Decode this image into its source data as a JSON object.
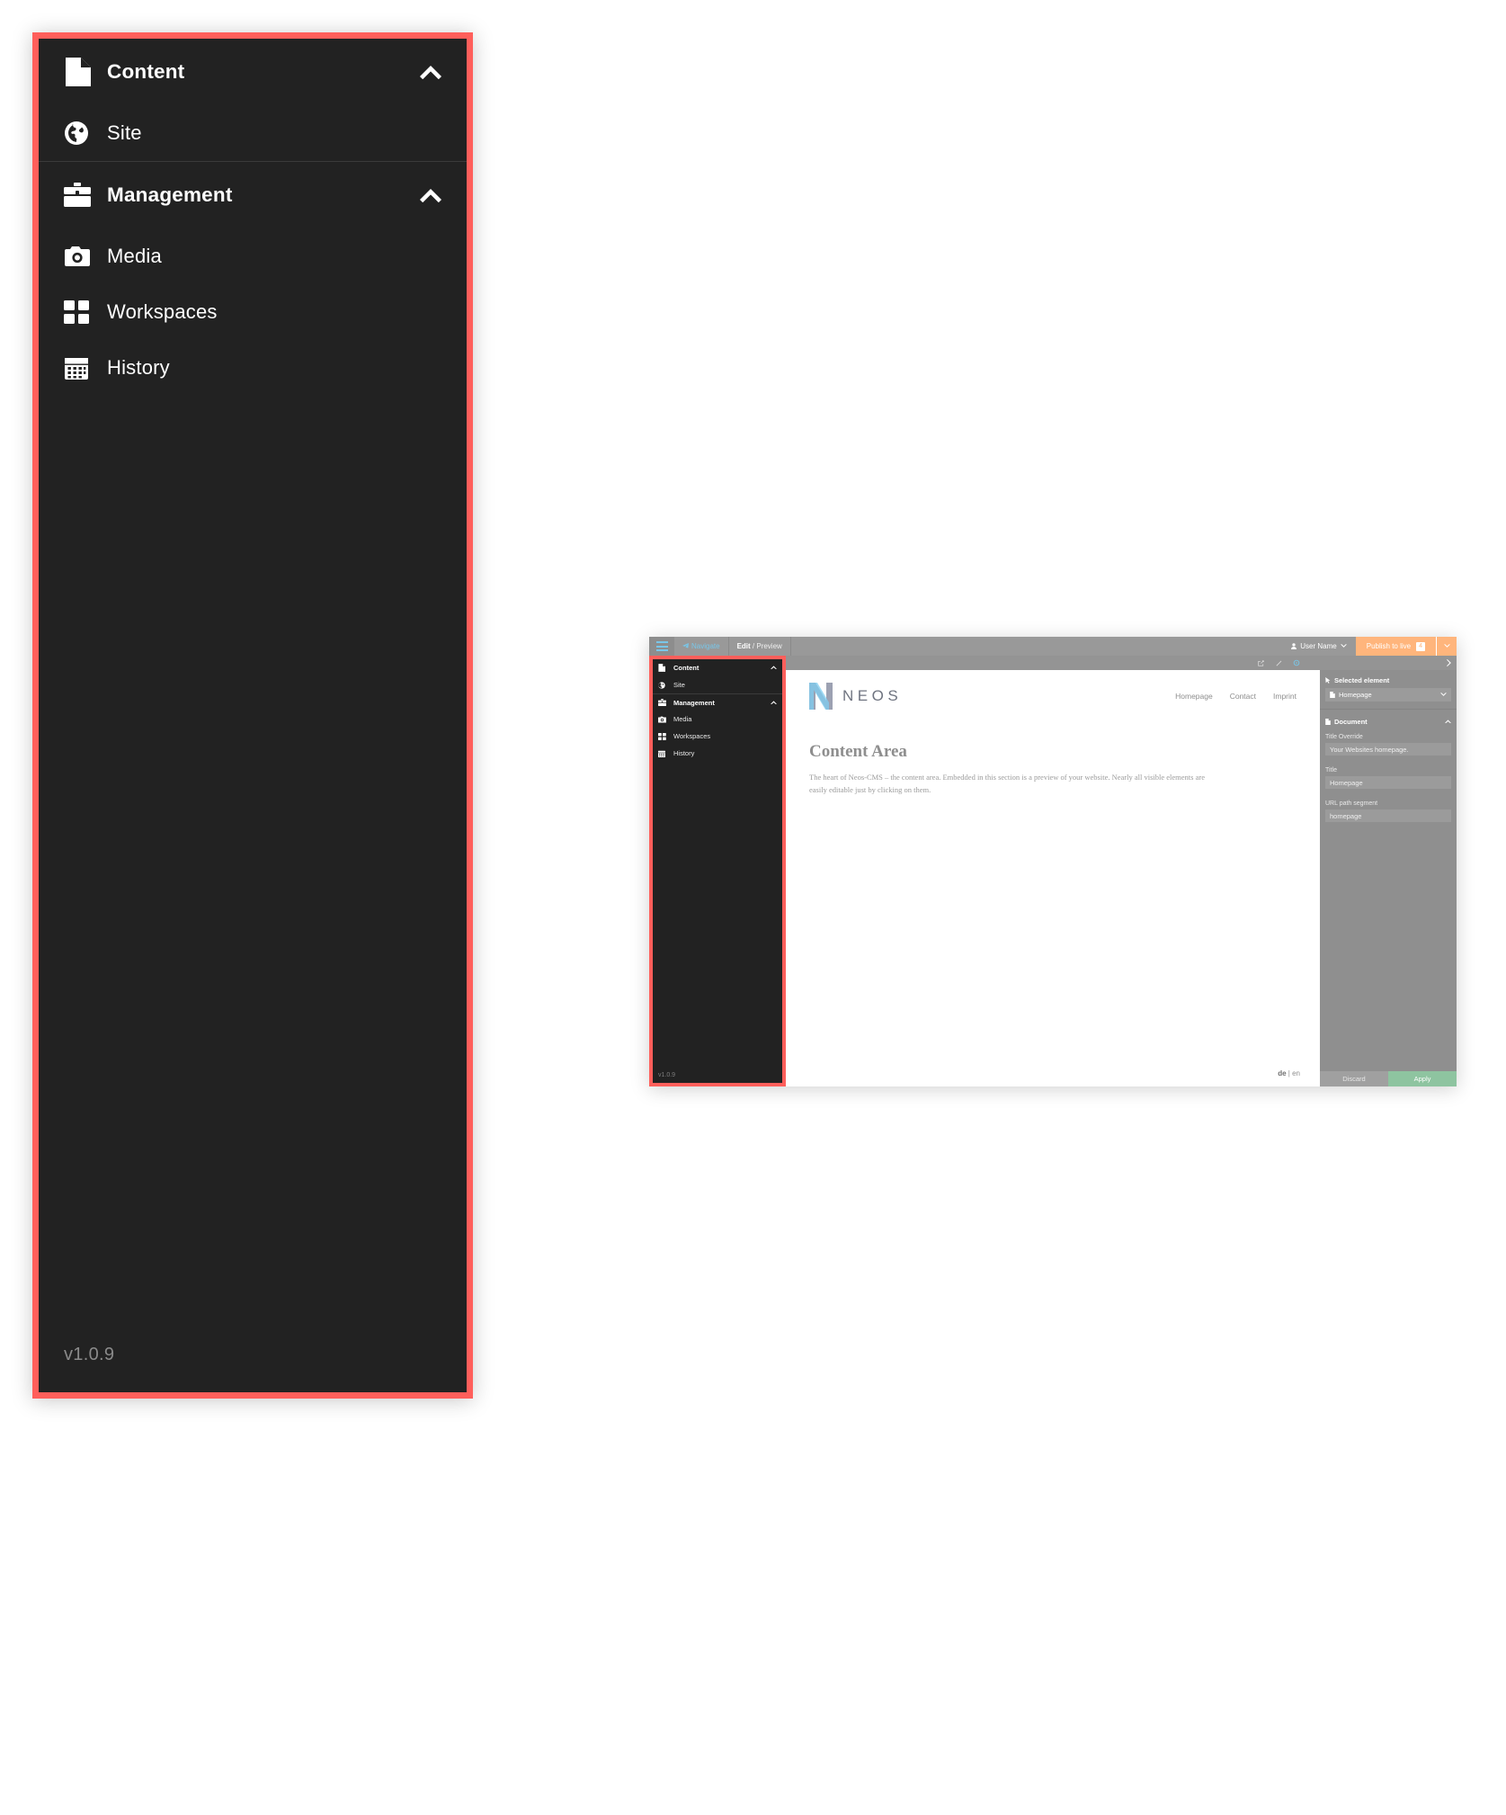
{
  "sidebar": {
    "groups": [
      {
        "header": {
          "label": "Content",
          "icon": "document-icon",
          "chevron": "chevron-up-icon"
        },
        "items": [
          {
            "label": "Site",
            "icon": "globe-icon"
          }
        ]
      },
      {
        "header": {
          "label": "Management",
          "icon": "briefcase-icon",
          "chevron": "chevron-up-icon"
        },
        "items": [
          {
            "label": "Media",
            "icon": "camera-icon"
          },
          {
            "label": "Workspaces",
            "icon": "grid-icon"
          },
          {
            "label": "History",
            "icon": "calendar-icon"
          }
        ]
      }
    ],
    "version": "v1.0.9",
    "background_color": "#222222",
    "highlight_color": "#ff5f5b"
  },
  "mini_window": {
    "topbar": {
      "menu_icon": "hamburger-icon",
      "navigate_label": "Navigate",
      "navigate_icon": "paper-plane-icon",
      "edit_label": "Edit",
      "edit_separator": " / ",
      "preview_label": "Preview",
      "user_label": "User Name",
      "user_icon": "user-icon",
      "user_caret": "chevron-down-icon",
      "publish_label": "Publish to live",
      "publish_badge": "4",
      "publish_caret": "chevron-down-icon",
      "publish_color": "#ffb57c",
      "accent_color": "#79c6e8"
    },
    "secondbar": {
      "icons": [
        "external-link-icon",
        "edit-pencil-icon",
        "gear-icon"
      ],
      "active_icon": "gear-icon",
      "arrow_icon": "chevron-right-icon"
    },
    "sidebar": {
      "groups": [
        {
          "header": {
            "label": "Content",
            "icon": "document-icon",
            "chevron": "chevron-up-icon"
          },
          "items": [
            {
              "label": "Site",
              "icon": "globe-icon"
            }
          ]
        },
        {
          "header": {
            "label": "Management",
            "icon": "briefcase-icon",
            "chevron": "chevron-up-icon"
          },
          "items": [
            {
              "label": "Media",
              "icon": "camera-icon"
            },
            {
              "label": "Workspaces",
              "icon": "grid-icon"
            },
            {
              "label": "History",
              "icon": "calendar-icon"
            }
          ]
        }
      ],
      "version": "v1.0.9"
    },
    "site": {
      "logo_text": "NEOS",
      "logo_icon": "neos-logo-icon",
      "nav": [
        "Homepage",
        "Contact",
        "Imprint"
      ],
      "heading": "Content Area",
      "paragraph": "The heart of Neos-CMS – the content area. Embedded in this section is a preview of your website. Nearly all visible elements are easily editable just by clicking on them.",
      "lang_de": "de",
      "lang_sep": " | ",
      "lang_en": "en"
    },
    "inspector": {
      "selected_element_label": "Selected element",
      "selected_element_icon": "cursor-icon",
      "selected_value": "Homepage",
      "selected_value_icon": "document-icon",
      "selected_caret": "chevron-down-icon",
      "document_label": "Document",
      "document_icon": "document-icon",
      "document_chevron": "chevron-up-icon",
      "fields": [
        {
          "label": "Title Override",
          "value": "Your Websites homepage."
        },
        {
          "label": "Title",
          "value": "Homepage"
        },
        {
          "label": "URL path segment",
          "value": "homepage"
        }
      ],
      "discard_label": "Discard",
      "apply_label": "Apply",
      "apply_color": "#8ec4a0"
    }
  }
}
